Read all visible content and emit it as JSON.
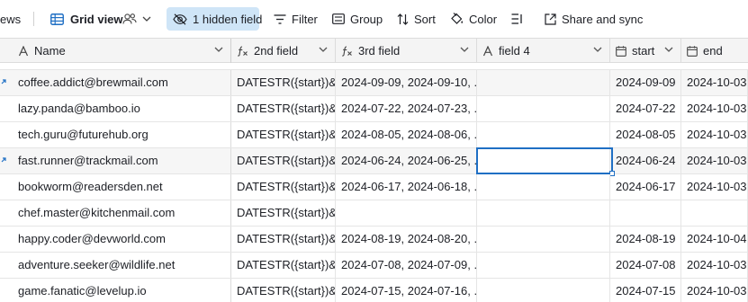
{
  "toolbar": {
    "views_label": "ews",
    "grid_view_label": "Grid view",
    "hidden_field_label": "1 hidden field",
    "filter_label": "Filter",
    "group_label": "Group",
    "sort_label": "Sort",
    "color_label": "Color",
    "share_label": "Share and sync",
    "accent_color": "#cfe5f7"
  },
  "columns": [
    {
      "label": "Name",
      "icon": "text-field-icon"
    },
    {
      "label": "2nd field",
      "icon": "formula-icon"
    },
    {
      "label": "3rd field",
      "icon": "formula-icon"
    },
    {
      "label": "field 4",
      "icon": "text-field-icon"
    },
    {
      "label": "start",
      "icon": "calendar-icon"
    },
    {
      "label": "end",
      "icon": "calendar-icon"
    }
  ],
  "rows": [
    {
      "name": "coffee.addict@brewmail.com",
      "f2": "DATESTR({start})&...",
      "f3": "2024-09-09, 2024-09-10, ...",
      "f4": "",
      "start": "2024-09-09",
      "end": "2024-10-03",
      "expand": true
    },
    {
      "name": "lazy.panda@bamboo.io",
      "f2": "DATESTR({start})&...",
      "f3": "2024-07-22, 2024-07-23, ...",
      "f4": "",
      "start": "2024-07-22",
      "end": "2024-10-03",
      "expand": false
    },
    {
      "name": "tech.guru@futurehub.org",
      "f2": "DATESTR({start})&...",
      "f3": "2024-08-05, 2024-08-06, ...",
      "f4": "",
      "start": "2024-08-05",
      "end": "2024-10-03",
      "expand": false
    },
    {
      "name": "fast.runner@trackmail.com",
      "f2": "DATESTR({start})&...",
      "f3": "2024-06-24, 2024-06-25, ...",
      "f4": "",
      "start": "2024-06-24",
      "end": "2024-10-03",
      "expand": true
    },
    {
      "name": "bookworm@readersden.net",
      "f2": "DATESTR({start})&...",
      "f3": "2024-06-17, 2024-06-18, ...",
      "f4": "",
      "start": "2024-06-17",
      "end": "2024-10-03",
      "expand": false
    },
    {
      "name": "chef.master@kitchenmail.com",
      "f2": "DATESTR({start})&...",
      "f3": "",
      "f4": "",
      "start": "",
      "end": "",
      "expand": false
    },
    {
      "name": "happy.coder@devworld.com",
      "f2": "DATESTR({start})&...",
      "f3": "2024-08-19, 2024-08-20, ...",
      "f4": "",
      "start": "2024-08-19",
      "end": "2024-10-04",
      "expand": false
    },
    {
      "name": "adventure.seeker@wildlife.net",
      "f2": "DATESTR({start})&...",
      "f3": "2024-07-08, 2024-07-09, ...",
      "f4": "",
      "start": "2024-07-08",
      "end": "2024-10-03",
      "expand": false
    },
    {
      "name": "game.fanatic@levelup.io",
      "f2": "DATESTR({start})&...",
      "f3": "2024-07-15, 2024-07-16, ...",
      "f4": "",
      "start": "2024-07-15",
      "end": "2024-10-03",
      "expand": false
    }
  ]
}
